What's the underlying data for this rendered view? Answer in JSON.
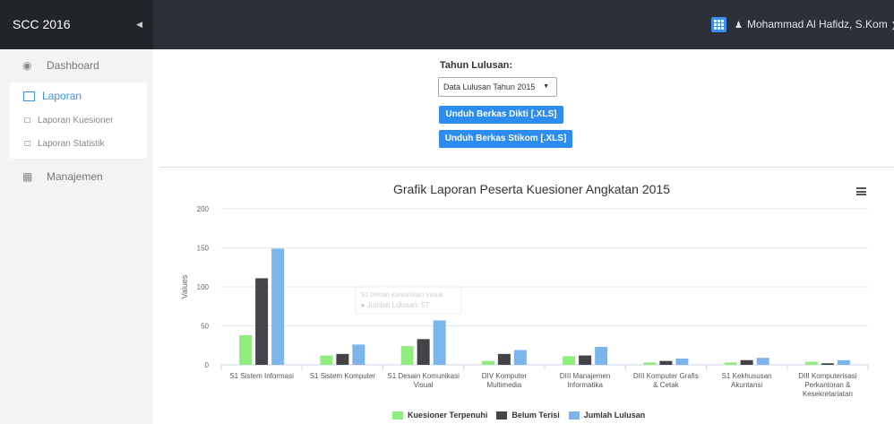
{
  "header": {
    "brand": "SCC 2016",
    "user_name": "Mohammad Al Hafidz, S.Kom"
  },
  "sidebar": {
    "dashboard": "Dashboard",
    "laporan": "Laporan",
    "laporan_kuesioner": "Laporan Kuesioner",
    "laporan_statistik": "Laporan Statistik",
    "manajemen": "Manajemen"
  },
  "controls": {
    "tahun_label": "Tahun Lulusan:",
    "tahun_selected": "Data Lulusan Tahun 2015",
    "btn_dikti": "Unduh Berkas Dikti [.XLS]",
    "btn_stikom": "Unduh Berkas Stikom [.XLS]"
  },
  "colors": {
    "accent": "#2d8cf0",
    "series_kuesioner": "#90ed7d",
    "series_belum": "#434348",
    "series_jumlah": "#7cb5ec"
  },
  "chart_data": {
    "type": "bar",
    "title": "Grafik Laporan Peserta Kuesioner Angkatan 2015",
    "ylabel": "Values",
    "ylim": [
      0,
      200
    ],
    "yticks": [
      0,
      50,
      100,
      150,
      200
    ],
    "categories": [
      "S1 Sistem Informasi",
      "S1 Sistem Komputer",
      "S1 Desain Komunikasi Visual",
      "DIV Komputer Multimedia",
      "DIII Manajemen Informatika",
      "DIII Komputer Grafis & Cetak",
      "S1 Kekhususan Akuntansi",
      "DIII Komputerisasi Perkantoran & Kesekretariatan"
    ],
    "series": [
      {
        "name": "Kuesioner Terpenuhi",
        "values": [
          38,
          12,
          24,
          5,
          11,
          3,
          3,
          4
        ]
      },
      {
        "name": "Belum Terisi",
        "values": [
          111,
          14,
          33,
          14,
          12,
          5,
          6,
          2
        ]
      },
      {
        "name": "Jumlah Lulusan",
        "values": [
          149,
          26,
          57,
          19,
          23,
          8,
          9,
          6
        ]
      }
    ],
    "legend": "bottom",
    "tooltip": {
      "category": "S1 Desain Komunikasi Visual",
      "series": "Jumlah Lulusan",
      "value": 57
    }
  }
}
